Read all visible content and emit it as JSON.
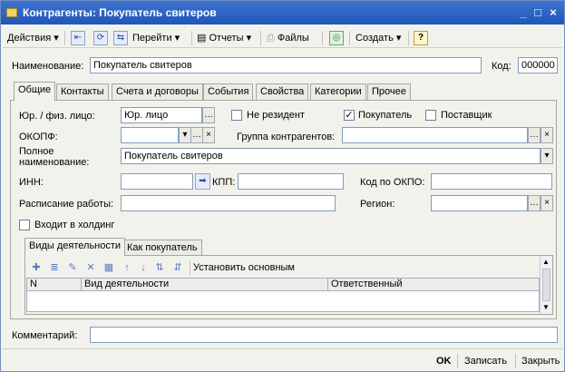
{
  "window": {
    "title": "Контрагенты: Покупатель свитеров",
    "controls": [
      "_",
      "□",
      "×"
    ]
  },
  "toolbar": {
    "actions_label": "Действия",
    "goto_label": "Перейти",
    "reports_label": "Отчеты",
    "files_label": "Файлы",
    "create_label": "Создать",
    "help_label": "?"
  },
  "header": {
    "name_label": "Наименование:",
    "name_value": "Покупатель свитеров",
    "code_label": "Код:",
    "code_value": "000000"
  },
  "tabs": [
    "Общие",
    "Контакты",
    "Счета и договоры",
    "События",
    "Свойства",
    "Категории",
    "Прочее"
  ],
  "general": {
    "entity_label": "Юр. / физ. лицо:",
    "entity_value": "Юр. лицо",
    "nonresident_label": "Не резидент",
    "buyer_label": "Покупатель",
    "supplier_label": "Поставщик",
    "okopf_label": "ОКОПФ:",
    "okopf_value": "",
    "group_label": "Группа контрагентов:",
    "group_value": "",
    "fullname_label": "Полное\nнаименование:",
    "fullname_value": "Покупатель свитеров",
    "inn_label": "ИНН:",
    "inn_value": "",
    "kpp_label": "КПП:",
    "kpp_value": "",
    "okpo_label": "Код по ОКПО:",
    "okpo_value": "",
    "schedule_label": "Расписание работы:",
    "schedule_value": "",
    "region_label": "Регион:",
    "region_value": "",
    "holding_label": "Входит в холдинг"
  },
  "checks": {
    "nonresident": false,
    "buyer": true,
    "supplier": false,
    "holding": false
  },
  "subtabs": [
    "Виды деятельности",
    "Как покупатель"
  ],
  "activities": {
    "set_main_label": "Установить основным",
    "columns": [
      "N",
      "Вид деятельности",
      "Ответственный"
    ],
    "rows": []
  },
  "comment": {
    "label": "Комментарий:",
    "value": ""
  },
  "footer": {
    "ok_label": "OK",
    "save_label": "Записать",
    "close_label": "Закрыть"
  },
  "colors": {
    "title_bar": "#2a5fc2",
    "window_bg": "#f2f2ec",
    "field_border": "#7f9db9"
  }
}
